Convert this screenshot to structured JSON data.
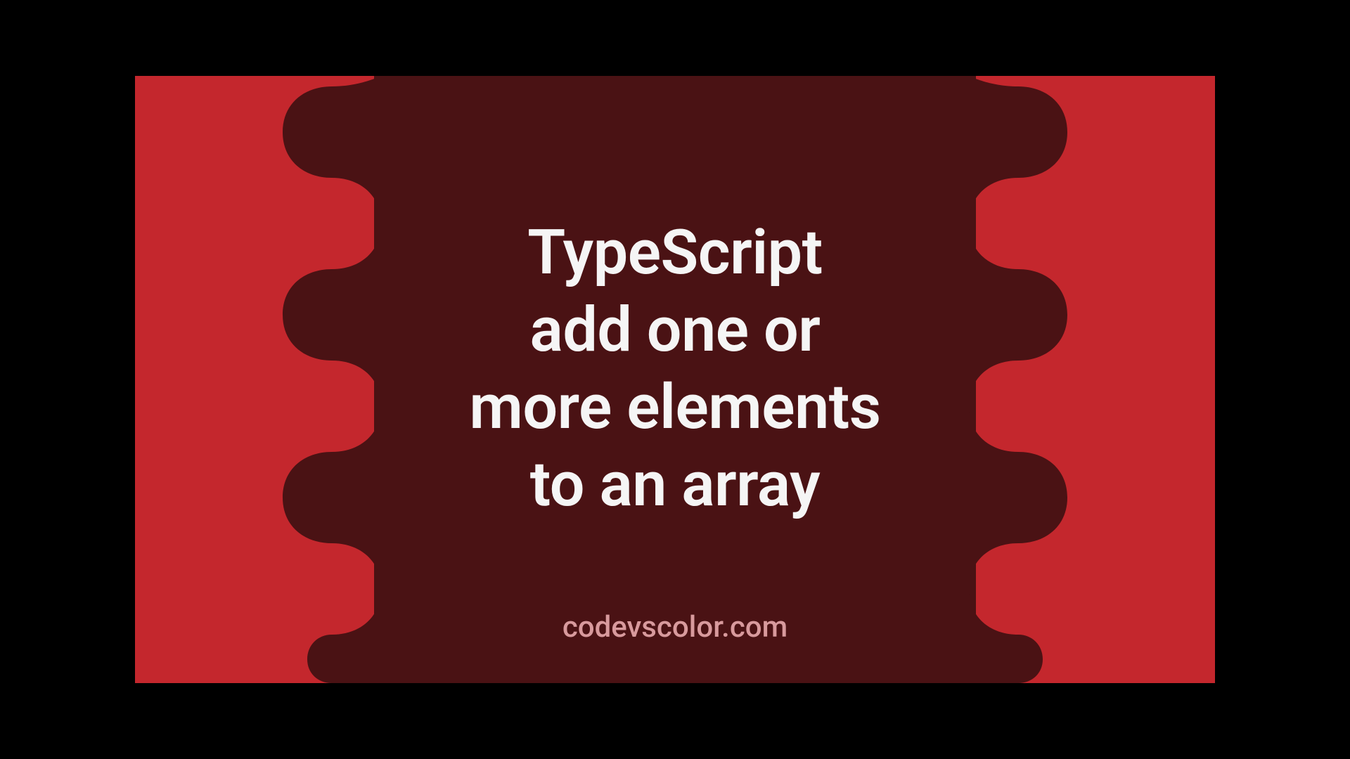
{
  "title": {
    "line1": "TypeScript",
    "line2": "add one or",
    "line3": "more elements",
    "line4": "to an array"
  },
  "watermark": "codevscolor.com",
  "colors": {
    "background_outer": "#C4272D",
    "background_inner": "#4A1214",
    "text_primary": "#F5F5F5",
    "text_watermark": "#D89A9D"
  }
}
